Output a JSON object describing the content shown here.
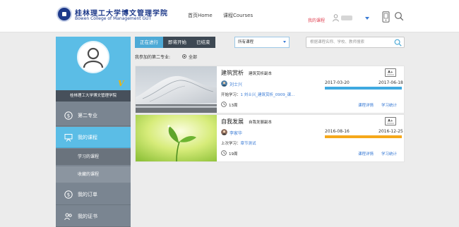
{
  "header": {
    "brand_cn": "桂林理工大学博文管理学院",
    "brand_en": "Bowen College of Management GUT",
    "nav": [
      {
        "label": "首页Home"
      },
      {
        "label": "课程Courses"
      }
    ],
    "my_course_link": "我的课程"
  },
  "sidebar": {
    "school": "桂林理工大学博文管理学院",
    "badge": "V",
    "items": [
      {
        "label": "第二专业",
        "icon": "money-icon"
      },
      {
        "label": "我的课程",
        "icon": "presentation-icon"
      },
      {
        "label": "我的订单",
        "icon": "money-icon"
      },
      {
        "label": "我的证书",
        "icon": "users-icon"
      }
    ],
    "sub_items": [
      {
        "label": "学习的课程"
      },
      {
        "label": "收藏的课程"
      }
    ]
  },
  "toolbar": {
    "tabs": [
      {
        "label": "正在进行",
        "active": true
      },
      {
        "label": "即将开始",
        "active": false
      },
      {
        "label": "已结束",
        "active": false
      }
    ],
    "select_value": "所有课程",
    "search_placeholder": "根据课程名称、学校、教师搜索"
  },
  "filter": {
    "label": "我参加的第二专业:",
    "option": "全部"
  },
  "courses": [
    {
      "title": "建筑赏析",
      "subtitle": "建筑赏析副本",
      "teacher": "刘士兴",
      "learn_label": "开始学习：",
      "learn_link": "1 刘士兴_建筑赏析_0909_课...",
      "duration": "13周",
      "start_date": "2017-03-20",
      "end_date": "2017-06-18",
      "progress": 1.0,
      "bar_color": "#3fa9e0",
      "detail": "课程详情",
      "stats": "学习统计"
    },
    {
      "title": "自我发展",
      "subtitle": "自我发展副本",
      "teacher": "李家华",
      "learn_label": "上次学习：",
      "learn_link": "章节测试",
      "duration": "19周",
      "start_date": "2016-08-16",
      "end_date": "2016-12-25",
      "progress": 1.0,
      "bar_color": "#f5a81a",
      "detail": "课程详情",
      "stats": "学习统计"
    }
  ]
}
